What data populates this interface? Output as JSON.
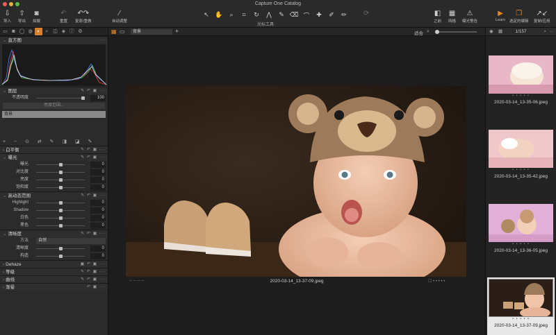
{
  "window": {
    "title": "Capture One Catalog"
  },
  "toolbar": {
    "import": "导入",
    "export": "导出",
    "capture": "拍摄",
    "reset": "重置",
    "undo_redo": "复原/重做",
    "auto_adjust": "自动调整",
    "cursor_tools": "光标工具",
    "before": "之前",
    "grid": "网格",
    "exposure_warning": "曝光警告",
    "learn": "Learn",
    "edit_selected": "选定的编辑",
    "copy_apply": "复制/应用"
  },
  "viewer_bar": {
    "preset": "背景",
    "fit": "适合"
  },
  "histogram": {
    "title": "直方图",
    "colors": {
      "red": "#e0443a",
      "green": "#4cc04c",
      "blue": "#4a7cf0",
      "luma": "#d8d8d8"
    }
  },
  "layers": {
    "title": "图层",
    "opacity_label": "不透明度",
    "opacity_value": "100",
    "refine_mask": "亮度范围...",
    "layer_name": "背景"
  },
  "white_balance": {
    "title": "白平衡"
  },
  "exposure": {
    "title": "曝光",
    "rows": [
      {
        "label": "曝光",
        "value": "0"
      },
      {
        "label": "对比度",
        "value": "0"
      },
      {
        "label": "亮度",
        "value": "0"
      },
      {
        "label": "饱和度",
        "value": "0"
      }
    ]
  },
  "hdr": {
    "title": "高动态范围",
    "rows": [
      {
        "label": "Highlight",
        "value": "0"
      },
      {
        "label": "Shadow",
        "value": "0"
      },
      {
        "label": "白色",
        "value": "0"
      },
      {
        "label": "黑色",
        "value": "0"
      }
    ]
  },
  "clarity": {
    "title": "清晰度",
    "method_label": "方法",
    "method_value": "自然",
    "rows": [
      {
        "label": "清晰度",
        "value": "0"
      },
      {
        "label": "构造",
        "value": "0"
      }
    ]
  },
  "dehaze": {
    "title": "Dehaze"
  },
  "levels": {
    "title": "等级"
  },
  "curves": {
    "title": "曲线"
  },
  "vignette": {
    "title": "渐晕"
  },
  "viewer": {
    "caption": "2020-03-14_13-37-09.jpeg",
    "meta": "-- -- -- --"
  },
  "browser": {
    "counter": "1/157",
    "thumbs": [
      {
        "name": "2020-03-14_13-35-06.jpeg",
        "rating": "• • • • •"
      },
      {
        "name": "2020-03-14_13-35-42.jpeg",
        "rating": "• • • • •"
      },
      {
        "name": "2020-03-14_13-36-05.jpeg",
        "rating": "• • • • •"
      },
      {
        "name": "2020-03-14_13-37-09.jpeg",
        "rating": "• • • • •"
      }
    ]
  },
  "accent": "#e4862a"
}
